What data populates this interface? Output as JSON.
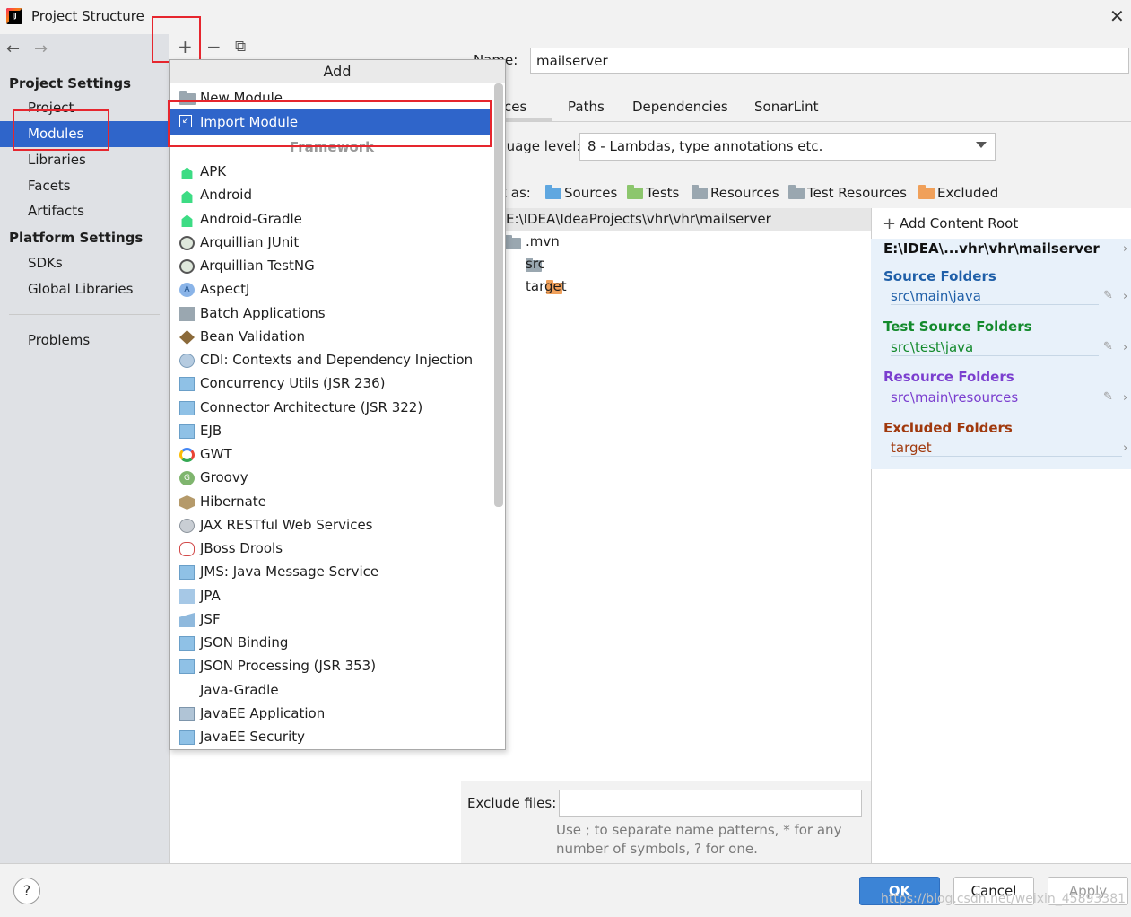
{
  "window": {
    "title": "Project Structure",
    "close_glyph": "✕"
  },
  "nav": {
    "back_glyph": "←",
    "forward_glyph": "→",
    "project_settings": "Project Settings",
    "project_items": [
      "Project",
      "Modules",
      "Libraries",
      "Facets",
      "Artifacts"
    ],
    "platform_settings": "Platform Settings",
    "platform_items": [
      "SDKs",
      "Global Libraries"
    ],
    "problems": "Problems",
    "selected": "Modules"
  },
  "toolbar": {
    "add_glyph": "+",
    "remove_glyph": "−",
    "copy_glyph": "⧉"
  },
  "popup": {
    "title": "Add",
    "items": [
      {
        "label": "New Module",
        "icon": "folder-icon"
      },
      {
        "label": "Import Module",
        "icon": "import-icon",
        "selected": true
      }
    ],
    "framework_header": "Framework",
    "frameworks": [
      {
        "label": "APK",
        "icon": "android-icon"
      },
      {
        "label": "Android",
        "icon": "android-icon"
      },
      {
        "label": "Android-Gradle",
        "icon": "android-icon"
      },
      {
        "label": "Arquillian JUnit",
        "icon": "arquillian-icon"
      },
      {
        "label": "Arquillian TestNG",
        "icon": "arquillian-icon"
      },
      {
        "label": "AspectJ",
        "icon": "aspectj-icon"
      },
      {
        "label": "Batch Applications",
        "icon": "batch-icon"
      },
      {
        "label": "Bean Validation",
        "icon": "bean-validation-icon"
      },
      {
        "label": "CDI: Contexts and Dependency Injection",
        "icon": "cdi-icon"
      },
      {
        "label": "Concurrency Utils (JSR 236)",
        "icon": "javaee-icon"
      },
      {
        "label": "Connector Architecture (JSR 322)",
        "icon": "javaee-icon"
      },
      {
        "label": "EJB",
        "icon": "javaee-icon"
      },
      {
        "label": "GWT",
        "icon": "google-icon"
      },
      {
        "label": "Groovy",
        "icon": "groovy-icon"
      },
      {
        "label": "Hibernate",
        "icon": "hibernate-icon"
      },
      {
        "label": "JAX RESTful Web Services",
        "icon": "globe-icon"
      },
      {
        "label": "JBoss Drools",
        "icon": "drools-icon"
      },
      {
        "label": "JMS: Java Message Service",
        "icon": "javaee-icon"
      },
      {
        "label": "JPA",
        "icon": "jpa-icon"
      },
      {
        "label": "JSF",
        "icon": "jsf-icon"
      },
      {
        "label": "JSON Binding",
        "icon": "javaee-icon"
      },
      {
        "label": "JSON Processing (JSR 353)",
        "icon": "javaee-icon"
      },
      {
        "label": "Java-Gradle",
        "icon": ""
      },
      {
        "label": "JavaEE Application",
        "icon": "javaee-app-icon"
      },
      {
        "label": "JavaEE Security",
        "icon": "javaee-icon"
      }
    ]
  },
  "module": {
    "name_label": "Name:",
    "name_value": "mailserver",
    "tabs": [
      "Sources",
      "Paths",
      "Dependencies",
      "SonarLint"
    ],
    "active_tab": "Sources",
    "language_level_label": "Language level:",
    "language_level_value": "8 - Lambdas, type annotations etc.",
    "mark_as_label": "Mark as:",
    "mark_as": [
      {
        "label": "Sources",
        "color": "#5fa7e0"
      },
      {
        "label": "Tests",
        "color": "#8cc66d"
      },
      {
        "label": "Resources",
        "color": "#9aa7b0"
      },
      {
        "label": "Test Resources",
        "color": "#9aa7b0"
      },
      {
        "label": "Excluded",
        "color": "#f0a05a"
      }
    ],
    "tree_root": "E:\\IDEA\\IdeaProjects\\vhr\\vhr\\mailserver",
    "tree_children": [
      {
        "label": ".mvn",
        "color": "#9aa7b0"
      },
      {
        "label": "src",
        "color": "#9aa7b0"
      },
      {
        "label": "target",
        "color": "#f0a05a"
      }
    ],
    "exclude_label": "Exclude files:",
    "exclude_value": "",
    "hint": "Use ; to separate name patterns, * for any number of symbols, ? for one."
  },
  "content_roots": {
    "add_label": "Add Content Root",
    "root_path": "E:\\IDEA\\...vhr\\vhr\\mailserver",
    "groups": [
      {
        "title": "Source Folders",
        "value": "src\\main\\java",
        "color": "#1f5fa8"
      },
      {
        "title": "Test Source Folders",
        "value": "src\\test\\java",
        "color": "#138a2c"
      },
      {
        "title": "Resource Folders",
        "value": "src\\main\\resources",
        "color": "#7b3fcf"
      },
      {
        "title": "Excluded Folders",
        "value": "target",
        "color": "#a0390d"
      }
    ]
  },
  "footer": {
    "help": "?",
    "ok": "OK",
    "cancel": "Cancel",
    "apply": "Apply",
    "watermark": "https://blog.csdn.net/weixin_45893381"
  }
}
